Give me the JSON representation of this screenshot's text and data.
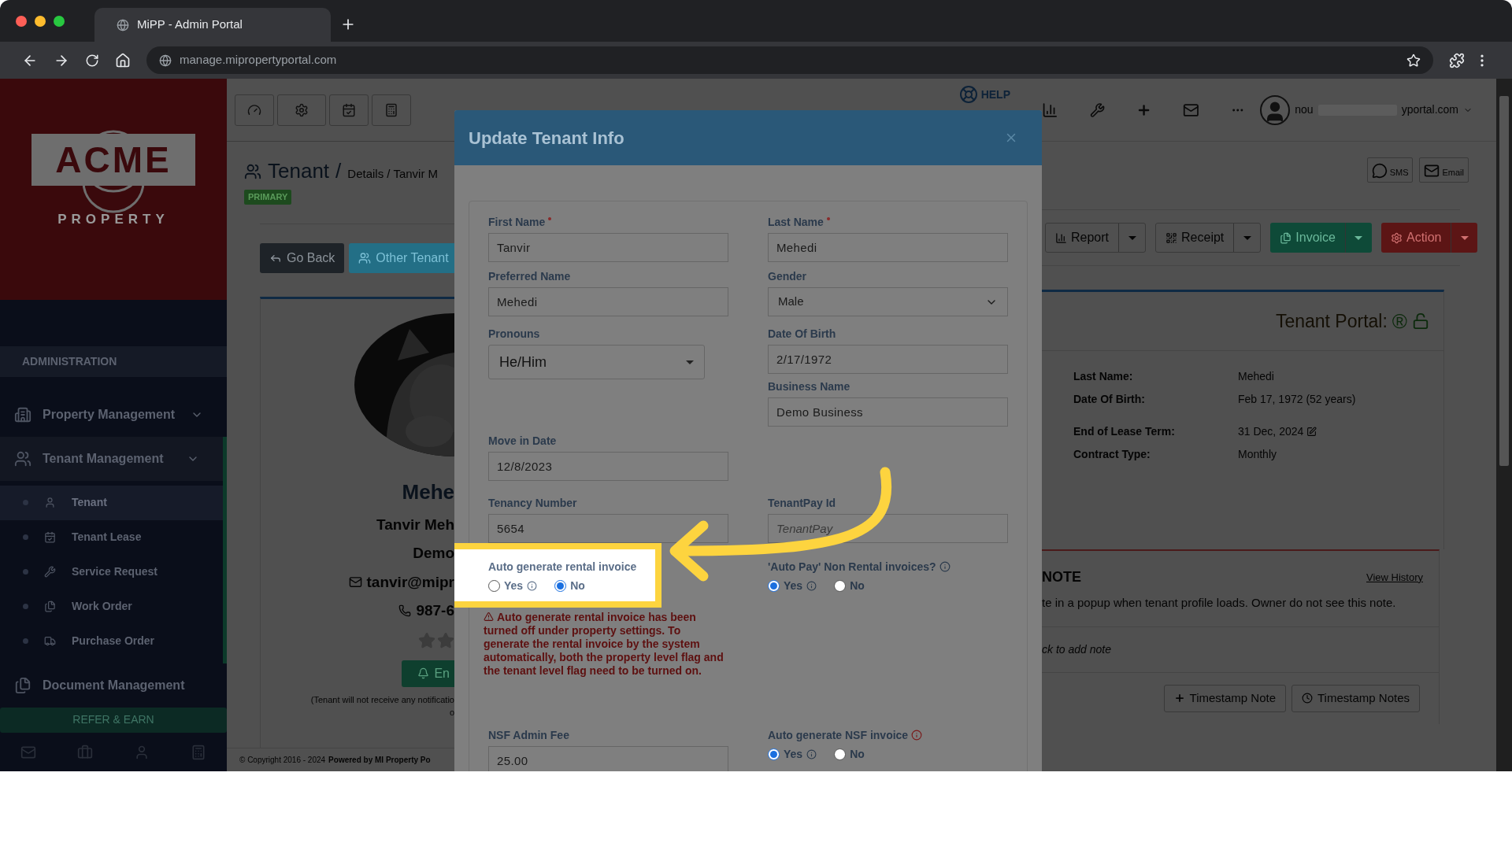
{
  "browser": {
    "tab_title": "MiPP - Admin Portal",
    "url": "manage.mipropertyportal.com"
  },
  "sidebar": {
    "logo": {
      "name": "ACME",
      "tagline": "PROPERTY"
    },
    "section": "ADMINISTRATION",
    "items": [
      {
        "label": "Property Management",
        "selected": false,
        "chevron": true
      },
      {
        "label": "Tenant Management",
        "selected": true,
        "chevron": true,
        "children": [
          {
            "label": "Tenant",
            "selected": true
          },
          {
            "label": "Tenant Lease",
            "selected": false
          },
          {
            "label": "Service Request",
            "selected": false
          },
          {
            "label": "Work Order",
            "selected": false
          },
          {
            "label": "Purchase Order",
            "selected": false
          }
        ]
      },
      {
        "label": "Document Management",
        "selected": false,
        "chevron": false
      }
    ],
    "refer_button": "REFER & EARN"
  },
  "page": {
    "title": "Tenant",
    "separator": "/",
    "breadcrumb": "Details / Tanvir M",
    "badge": "PRIMARY",
    "buttons": [
      {
        "label": "Go Back",
        "kind": "dark"
      },
      {
        "label": "Other Tenant",
        "kind": "info"
      }
    ],
    "profile": {
      "name": "Mehe",
      "full_name": "Tanvir Meh",
      "business": "Demo",
      "email": "tanvir@mipr",
      "phone": "987-6",
      "button": "En",
      "notice": "(Tenant will not receive any notificatio",
      "notice_end": "o"
    },
    "footer": {
      "copyright": "© Copyright 2016 - 2024",
      "powered": "Powered by MI Property Po"
    }
  },
  "header": {
    "help": "HELP",
    "user_start": "nou",
    "user_end": "yportal.com",
    "sms": "SMS",
    "email": "Email"
  },
  "actions": [
    {
      "label": "Report",
      "kind": "default"
    },
    {
      "label": "Receipt",
      "kind": "default"
    },
    {
      "label": "Invoice",
      "kind": "success"
    },
    {
      "label": "Action",
      "kind": "danger"
    }
  ],
  "portal": {
    "title": "Tenant Portal:",
    "mark": "®",
    "locked": false,
    "groups": [
      [
        {
          "label": "Last Name:",
          "value": "Mehedi"
        },
        {
          "label": "Date Of Birth:",
          "value": "Feb 17, 1972 (52 years)"
        }
      ],
      [
        {
          "label": "End of Lease Term:",
          "value": "31 Dec, 2024",
          "editable": true
        },
        {
          "label": "Contract Type:",
          "value": "Monthly"
        }
      ]
    ]
  },
  "note": {
    "title": "NOTE",
    "link": "View History",
    "text": "te in a popup when tenant profile loads. Owner do not see this note.",
    "placeholder": "ck to add note",
    "buttons": [
      "Timestamp Note",
      "Timestamp Notes"
    ]
  },
  "modal": {
    "title": "Update Tenant Info",
    "rows": [
      {
        "left": [
          {
            "kind": "text",
            "label": "First Name",
            "required": true,
            "value": "Tanvir"
          }
        ],
        "right": [
          {
            "kind": "text",
            "label": "Last Name",
            "required": true,
            "value": "Mehedi"
          }
        ]
      },
      {
        "left": [
          {
            "kind": "text",
            "label": "Preferred Name",
            "value": "Mehedi"
          }
        ],
        "right": [
          {
            "kind": "select",
            "label": "Gender",
            "value": "Male"
          }
        ]
      },
      {
        "left": [
          {
            "kind": "dropdown",
            "label": "Pronouns",
            "value": "He/Him"
          }
        ],
        "right": [
          {
            "kind": "text",
            "label": "Date Of Birth",
            "value": "2/17/1972"
          },
          {
            "kind": "text",
            "label": "Business Name",
            "value": "Demo Business"
          }
        ]
      },
      {
        "left": [
          {
            "kind": "text",
            "label": "Move in Date",
            "value": "12/8/2023"
          }
        ]
      },
      {
        "left": [
          {
            "kind": "text",
            "label": "Tenancy Number",
            "value": "5654"
          }
        ],
        "right": [
          {
            "kind": "text",
            "label": "TenantPay Id",
            "placeholder": "TenantPay"
          }
        ]
      },
      {
        "left": [
          {
            "kind": "radio",
            "label": "Auto generate rental invoice",
            "highlighted": true,
            "options": [
              {
                "label": "Yes",
                "info": true,
                "selected": false
              },
              {
                "label": "No",
                "info": false,
                "selected": true
              }
            ],
            "warning": "Auto generate rental invoice has been turned off under property settings. To generate the rental invoice by the system automatically, both the property level flag and the tenant level flag need to be turned on."
          }
        ],
        "right": [
          {
            "kind": "radio",
            "label": "'Auto Pay' Non Rental invoices?",
            "info": true,
            "alert": false,
            "options": [
              {
                "label": "Yes",
                "info": true,
                "selected": true
              },
              {
                "label": "No",
                "info": false,
                "selected": false
              }
            ]
          }
        ]
      },
      {
        "left": [
          {
            "kind": "text",
            "label": "NSF Admin Fee",
            "value": "25.00"
          }
        ],
        "right": [
          {
            "kind": "radio",
            "label": "Auto generate NSF invoice",
            "info": true,
            "alert": true,
            "options": [
              {
                "label": "Yes",
                "info": true,
                "selected": true
              },
              {
                "label": "No",
                "info": false,
                "selected": false
              }
            ]
          }
        ]
      }
    ]
  }
}
